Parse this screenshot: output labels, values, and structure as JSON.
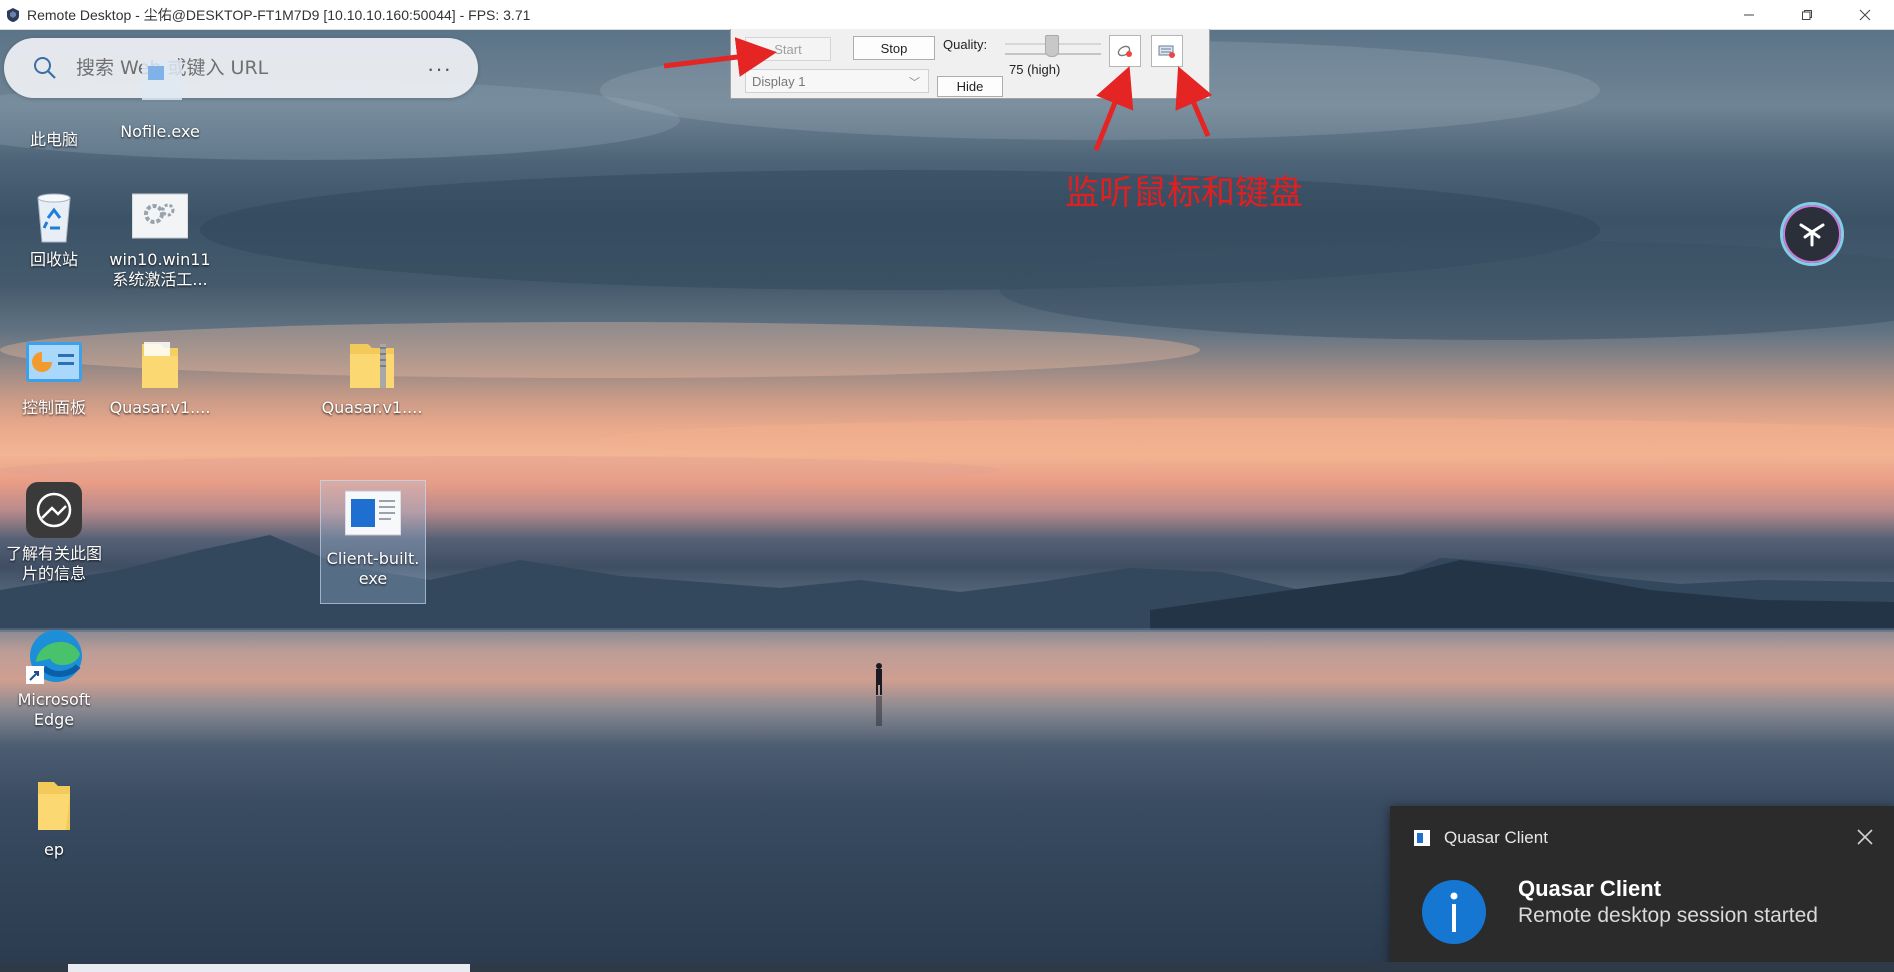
{
  "window": {
    "title": "Remote Desktop - 尘佑@DESKTOP-FT1M7D9 [10.10.10.160:50044] - FPS: 3.71",
    "app_icon": "shield-app-icon",
    "controls": [
      "minimize-icon",
      "maximize-icon",
      "close-icon"
    ]
  },
  "search": {
    "placeholder": "搜索 Web 或键入 URL",
    "icon": "search-icon",
    "more": "···"
  },
  "desktop_icons": [
    {
      "label": "此电脑",
      "icon": "computer-icon"
    },
    {
      "label": "Nofile.exe",
      "icon": "exe-icon"
    },
    {
      "label": "回收站",
      "icon": "recycle-bin-icon"
    },
    {
      "label": "win10.win11\n系统激活工...",
      "icon": "settings-file-icon"
    },
    {
      "label": "控制面板",
      "icon": "control-panel-icon"
    },
    {
      "label": "Quasar.v1....",
      "icon": "folder-icon"
    },
    {
      "label": "Quasar.v1....",
      "icon": "zip-folder-icon"
    },
    {
      "label": "了解有关此图\n片的信息",
      "icon": "camera-info-icon"
    },
    {
      "label": "Client-built.\nexe",
      "icon": "exe-icon"
    },
    {
      "label": "Microsoft\nEdge",
      "icon": "edge-icon"
    },
    {
      "label": "ep",
      "icon": "folder-icon"
    }
  ],
  "toolbar": {
    "start_label": "Start",
    "stop_label": "Stop",
    "quality_label": "Quality:",
    "quality_value_text": "75 (high)",
    "quality_value": 75,
    "display_selected": "Display 1",
    "hide_label": "Hide",
    "mouse_button_icon": "mouse-listen-icon",
    "keyboard_button_icon": "keyboard-listen-icon"
  },
  "annotation": {
    "text": "监听鼠标和键盘",
    "color": "#e02020"
  },
  "toast": {
    "app_name": "Quasar Client",
    "title": "Quasar Client",
    "message": "Remote desktop session started",
    "icon": "info-icon",
    "accent": "#1677d2"
  }
}
